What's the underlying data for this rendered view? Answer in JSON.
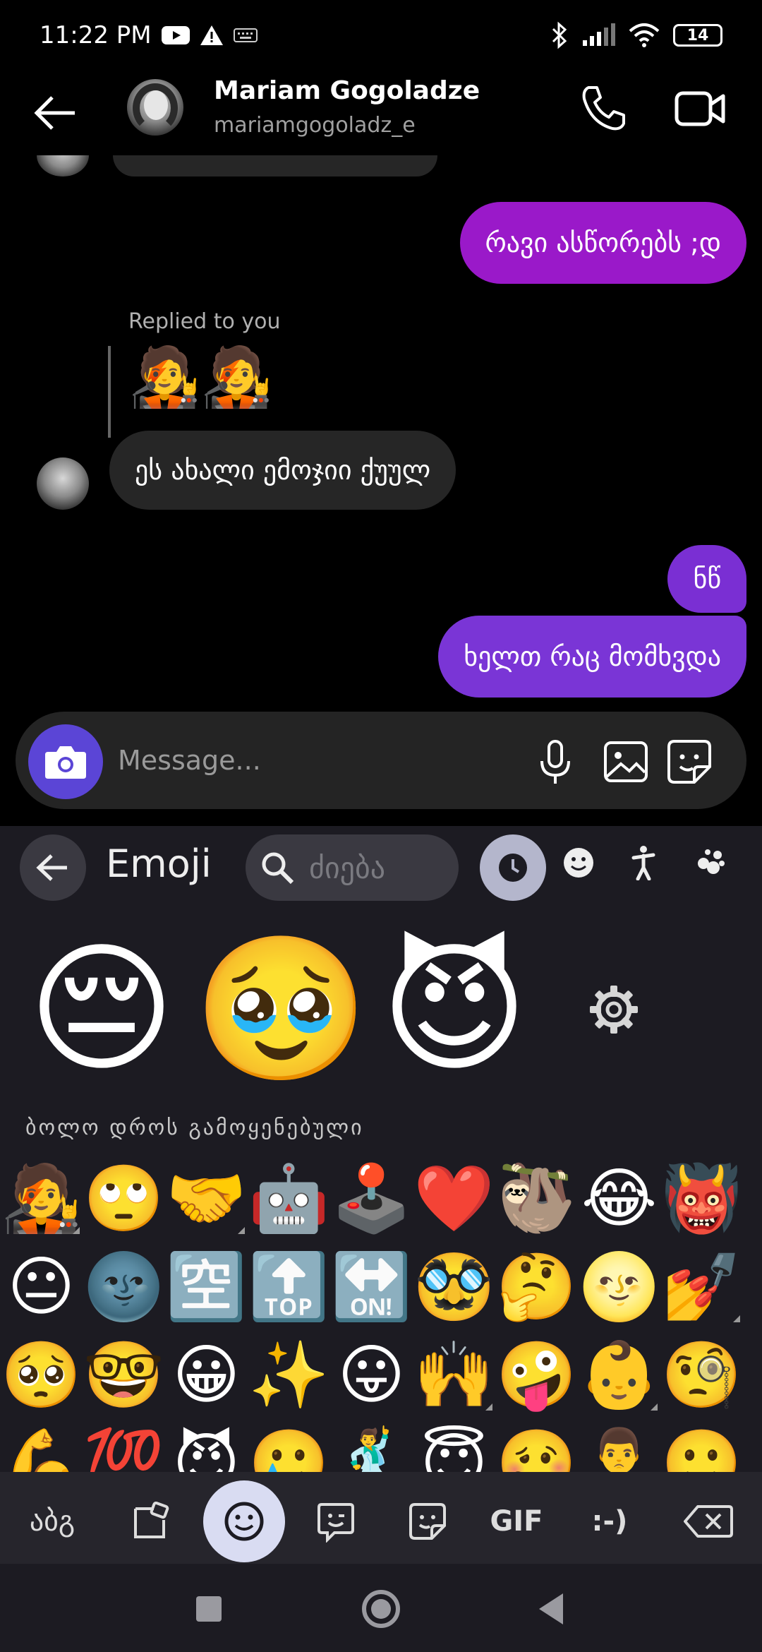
{
  "status": {
    "time": "11:22 PM",
    "battery": "14"
  },
  "header": {
    "name": "Mariam Gogoladze",
    "username": "mariamgogoladz_e"
  },
  "messages": {
    "out1": "რავი ასწორებს ;დ",
    "reply_label": "Replied to you",
    "reply_emoji": "🧑‍🎤🧑‍🎤",
    "in1": "ეს ახალი ემოჯიი ქუულ",
    "out2": "ნწ",
    "out3": "ხელთ რაც მომხვდა"
  },
  "composer": {
    "placeholder": "Message..."
  },
  "keyboard": {
    "title": "Emoji",
    "search_placeholder": "ძიება",
    "suggestions": [
      "😔",
      "🥹",
      "😈"
    ],
    "section_title": "ბოლო დროს გამოყენებული",
    "recent_rows": [
      [
        "🧑‍🎤",
        "🙄",
        "🤝",
        "🤖",
        "🕹️",
        "❤️",
        "🦥",
        "😂",
        "👹"
      ],
      [
        "😐",
        "🌚",
        "🈳",
        "🔝",
        "🔛",
        "🥸",
        "🤔",
        "🌝",
        "💅"
      ],
      [
        "🥺",
        "🤓",
        "😀",
        "✨",
        "😛",
        "🙌",
        "🤪",
        "👶",
        "🧐"
      ],
      [
        "💪",
        "💯",
        "😈",
        "🥲",
        "🕺",
        "😇",
        "🥴",
        "🙎‍♂️",
        "🙂"
      ]
    ],
    "tools": {
      "abc": "აბგ",
      "gif": "GIF",
      "emoticon": ":-)"
    }
  },
  "colors": {
    "out_bubble_1": "#9a19c9",
    "out_bubble_2": "#7a2fd3",
    "in_bubble": "#262626",
    "camera_button": "#5b45d6",
    "keyboard_bg": "#1c1b22"
  }
}
